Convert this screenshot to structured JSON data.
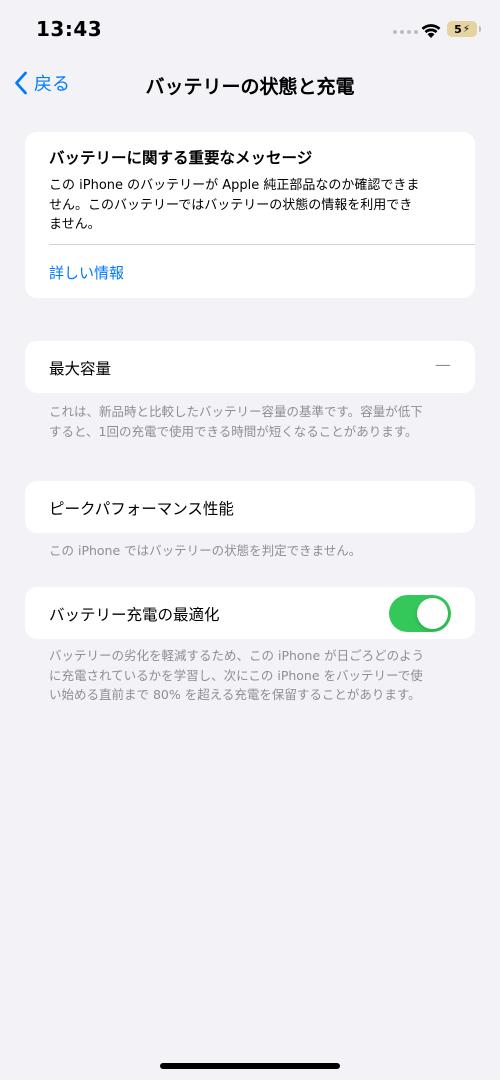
{
  "status_bar": {
    "time": "13:43",
    "battery_level": "5",
    "battery_color": "#E5D4A0"
  },
  "nav": {
    "back_label": "戻る",
    "title": "バッテリーの状態と充電"
  },
  "message": {
    "title": "バッテリーに関する重要なメッセージ",
    "body": "この iPhone のバッテリーが Apple 純正部品なのか確認できません。このバッテリーではバッテリーの状態の情報を利用できません。",
    "link": "詳しい情報"
  },
  "max_capacity": {
    "label": "最大容量",
    "value": "—",
    "note": "これは、新品時と比較したバッテリー容量の基準です。容量が低下すると、1回の充電で使用できる時間が短くなることがあります。"
  },
  "peak_performance": {
    "label": "ピークパフォーマンス性能",
    "note": "この iPhone ではバッテリーの状態を判定できません。"
  },
  "optimized_charging": {
    "label": "バッテリー充電の最適化",
    "enabled": true,
    "note": "バッテリーの劣化を軽減するため、この iPhone が日ごろどのように充電されているかを学習し、次にこの iPhone をバッテリーで使い始める直前まで 80% を超える充電を保留することがあります。"
  },
  "colors": {
    "accent": "#007AFF",
    "toggle_on": "#34C759",
    "background": "#F2F2F7",
    "secondary_text": "#8E8E93"
  },
  "icons": {
    "back": "chevron-left-icon",
    "wifi": "wifi-icon",
    "battery": "battery-icon",
    "signal": "cellular-signal-icon"
  }
}
